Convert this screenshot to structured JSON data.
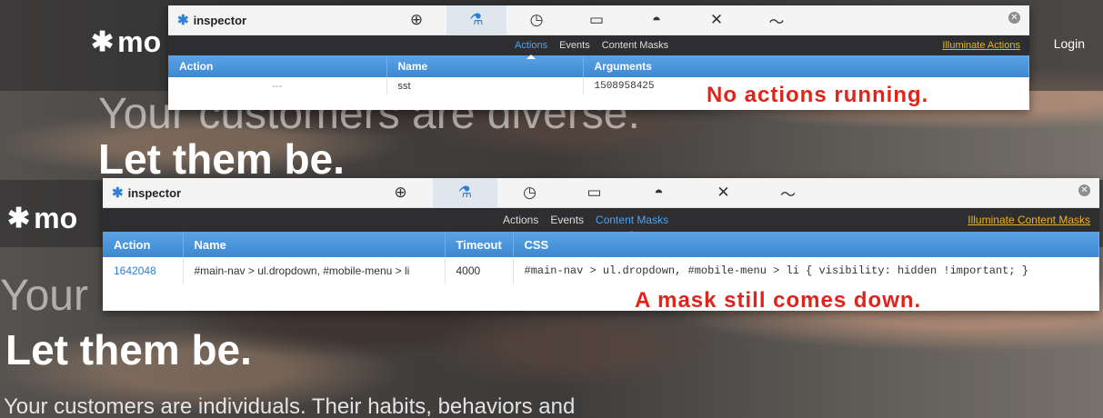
{
  "background": {
    "logo_text": "mo",
    "login_label": "Login",
    "headline_thin_top": "Your customers are diverse.",
    "headline_thin_bottom": "Your",
    "headline_bold": "Let them be.",
    "subheadline": "Your customers are individuals. Their habits, behaviors and"
  },
  "panel1": {
    "title": "inspector",
    "tools": [
      "target-icon",
      "flask-icon",
      "stopwatch-icon",
      "monitor-icon",
      "stack-icon",
      "tools-icon",
      "pulse-icon"
    ],
    "tabs": [
      "Actions",
      "Events",
      "Content Masks"
    ],
    "selected_tab": "Actions",
    "illuminate_label": "Illuminate Actions",
    "columns": [
      "Action",
      "Name",
      "Arguments"
    ],
    "row": {
      "action": "---",
      "name": "sst",
      "arguments": "1508958425"
    },
    "annotation": "No actions running."
  },
  "panel2": {
    "title": "inspector",
    "tabs": [
      "Actions",
      "Events",
      "Content Masks"
    ],
    "selected_tab": "Content Masks",
    "illuminate_label": "Illuminate Content Masks",
    "columns": [
      "Action",
      "Name",
      "Timeout",
      "CSS"
    ],
    "row": {
      "action": "1642048",
      "name": "#main-nav > ul.dropdown, #mobile-menu > li",
      "timeout": "4000",
      "css": "#main-nav > ul.dropdown, #mobile-menu > li { visibility: hidden !important; }"
    },
    "annotation": "A mask still comes down."
  },
  "colors": {
    "accent_blue": "#3d88d3",
    "illuminate_gold": "#e8b523",
    "annotation_red": "#e1241a",
    "subnav_dark": "#2e2e30"
  }
}
